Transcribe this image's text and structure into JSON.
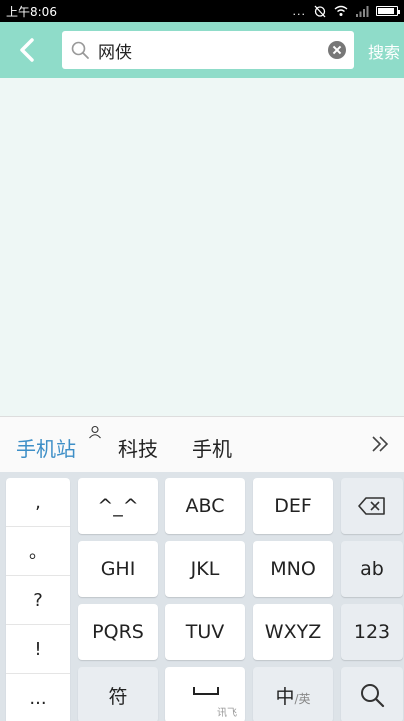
{
  "status_bar": {
    "time": "上午8:06",
    "dots": "..."
  },
  "header": {
    "search_value": "网侠",
    "search_button": "搜索"
  },
  "candidates": {
    "items": [
      "手机站",
      "科技",
      "手机"
    ]
  },
  "keyboard": {
    "punctuation": [
      ",",
      "。",
      "?",
      "!",
      "..."
    ],
    "rows": [
      [
        "^_^",
        "ABC",
        "DEF"
      ],
      [
        "GHI",
        "JKL",
        "MNO"
      ],
      [
        "PQRS",
        "TUV",
        "WXYZ"
      ]
    ],
    "right_keys": [
      "ab",
      "123"
    ],
    "symbol_key": "符",
    "space_sub": "讯飞",
    "lang_key_main": "中",
    "lang_key_sub": "/英"
  },
  "colors": {
    "header": "#8fdcc9",
    "candidate_primary": "#3e8fc7"
  }
}
